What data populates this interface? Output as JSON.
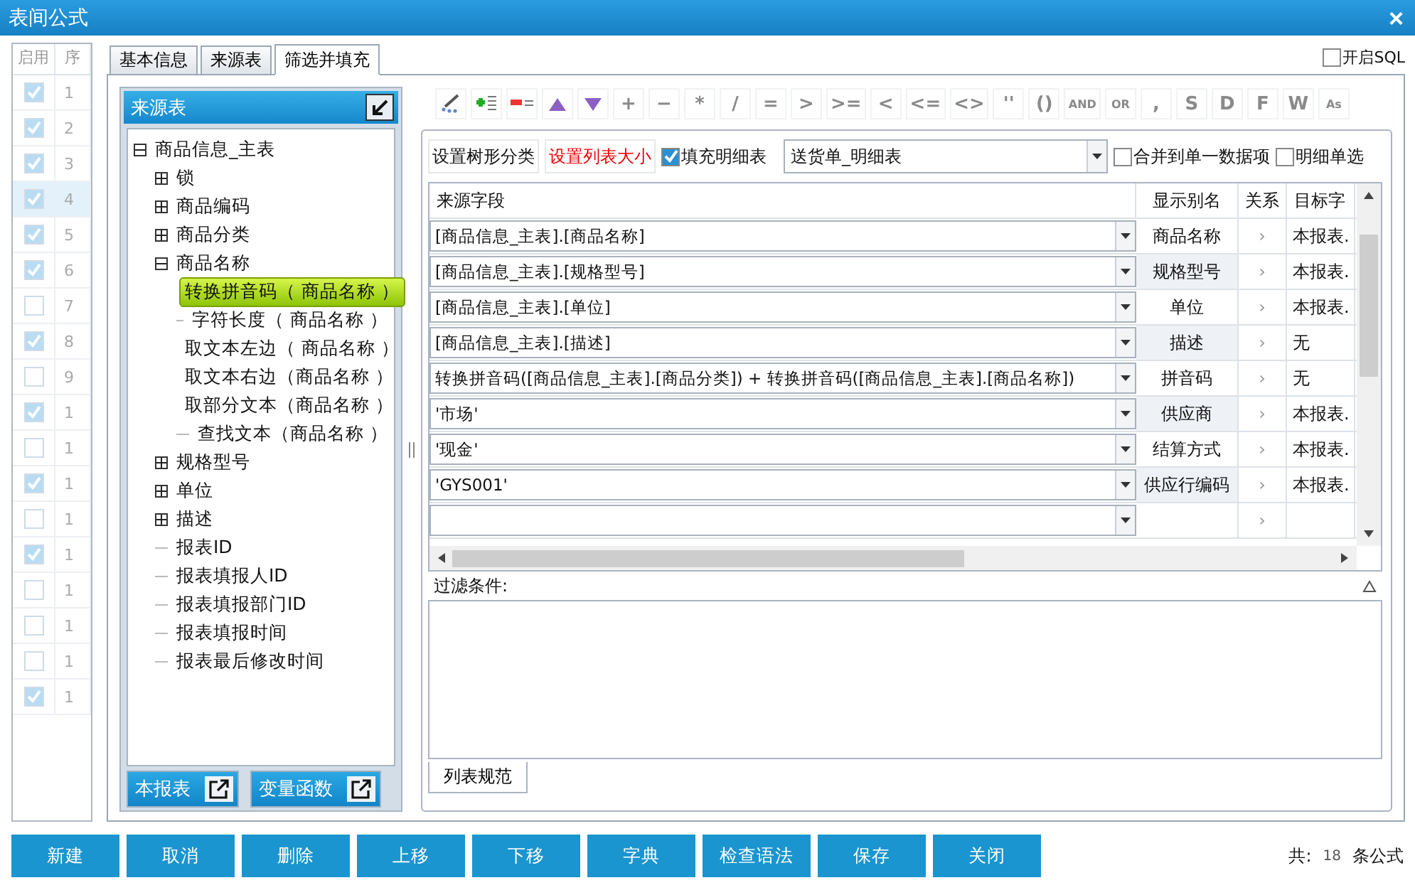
{
  "window": {
    "title": "表间公式",
    "close": "×"
  },
  "formula_list": {
    "columns": [
      "启用",
      "序"
    ],
    "rows": [
      {
        "enabled": true,
        "seq": "1",
        "selected": false
      },
      {
        "enabled": true,
        "seq": "2",
        "selected": false
      },
      {
        "enabled": true,
        "seq": "3",
        "selected": false
      },
      {
        "enabled": true,
        "seq": "4",
        "selected": true
      },
      {
        "enabled": true,
        "seq": "5",
        "selected": false
      },
      {
        "enabled": true,
        "seq": "6",
        "selected": false
      },
      {
        "enabled": false,
        "seq": "7",
        "selected": false
      },
      {
        "enabled": true,
        "seq": "8",
        "selected": false
      },
      {
        "enabled": false,
        "seq": "9",
        "selected": false
      },
      {
        "enabled": true,
        "seq": "1",
        "selected": false
      },
      {
        "enabled": false,
        "seq": "1",
        "selected": false
      },
      {
        "enabled": true,
        "seq": "1",
        "selected": false
      },
      {
        "enabled": false,
        "seq": "1",
        "selected": false
      },
      {
        "enabled": true,
        "seq": "1",
        "selected": false
      },
      {
        "enabled": false,
        "seq": "1",
        "selected": false
      },
      {
        "enabled": false,
        "seq": "1",
        "selected": false
      },
      {
        "enabled": false,
        "seq": "1",
        "selected": false
      },
      {
        "enabled": true,
        "seq": "1",
        "selected": false
      }
    ]
  },
  "tabs": [
    {
      "label": "基本信息",
      "selected": false
    },
    {
      "label": "来源表",
      "selected": false
    },
    {
      "label": "筛选并填充",
      "selected": true
    }
  ],
  "sql_toggle": {
    "label": "开启SQL",
    "checked": false
  },
  "source_panel": {
    "title": "来源表",
    "tree": [
      {
        "label": "商品信息_主表",
        "expanded": true,
        "selected": false,
        "children": [
          {
            "label": "锁",
            "expanded": false,
            "selected": false
          },
          {
            "label": "商品编码",
            "expanded": false,
            "selected": false
          },
          {
            "label": "商品分类",
            "expanded": false,
            "selected": false
          },
          {
            "label": "商品名称",
            "expanded": true,
            "selected": false,
            "children": [
              {
                "label": "转换拼音码（ 商品名称 ）",
                "selected": true
              },
              {
                "label": "字符长度（ 商品名称 ）",
                "selected": false
              },
              {
                "label": "取文本左边（ 商品名称 ）",
                "selected": false
              },
              {
                "label": "取文本右边（商品名称 ）",
                "selected": false
              },
              {
                "label": "取部分文本（商品名称 ）",
                "selected": false
              },
              {
                "label": "查找文本（商品名称 ）",
                "selected": false
              }
            ]
          },
          {
            "label": "规格型号",
            "expanded": false,
            "selected": false
          },
          {
            "label": "单位",
            "expanded": false,
            "selected": false
          },
          {
            "label": "描述",
            "expanded": false,
            "selected": false
          },
          {
            "label": "报表ID",
            "selected": false
          },
          {
            "label": "报表填报人ID",
            "selected": false
          },
          {
            "label": "报表填报部门ID",
            "selected": false
          },
          {
            "label": "报表填报时间",
            "selected": false
          },
          {
            "label": "报表最后修改时间",
            "selected": false
          }
        ]
      }
    ],
    "buttons": [
      "本报表",
      "变量函数"
    ]
  },
  "toolbar": {
    "icon_tools": [
      {
        "kind": "wand"
      },
      {
        "kind": "addrow"
      },
      {
        "kind": "delrow"
      },
      {
        "kind": "up"
      },
      {
        "kind": "down"
      }
    ],
    "operators": [
      "+",
      "−",
      "*",
      "/",
      "=",
      ">",
      ">=",
      "<",
      "<=",
      "<>",
      "''",
      "()",
      "AND",
      "OR",
      ",",
      "S",
      "D",
      "F",
      "W",
      "As"
    ]
  },
  "options": {
    "tree_category": "设置树形分类",
    "list_size": "设置列表大小",
    "fill_detail": {
      "label": "填充明细表",
      "checked": true
    },
    "detail_table": "送货单_明细表",
    "merge_single": {
      "label": "合并到单一数据项",
      "checked": false
    },
    "detail_single": {
      "label": "明细单选",
      "checked": false
    }
  },
  "mapping": {
    "columns": [
      "来源字段",
      "显示别名",
      "关系",
      "目标字"
    ],
    "rows": [
      {
        "source": "[商品信息_主表].[商品名称]",
        "alias": "商品名称",
        "relation": "›",
        "target": "本报表."
      },
      {
        "source": "[商品信息_主表].[规格型号]",
        "alias": "规格型号",
        "relation": "›",
        "target": "本报表."
      },
      {
        "source": "[商品信息_主表].[单位]",
        "alias": "单位",
        "relation": "›",
        "target": "本报表."
      },
      {
        "source": "[商品信息_主表].[描述]",
        "alias": "描述",
        "relation": "›",
        "target": "无"
      },
      {
        "source": "转换拼音码([商品信息_主表].[商品分类]) + 转换拼音码([商品信息_主表].[商品名称])",
        "alias": "拼音码",
        "relation": "›",
        "target": "无"
      },
      {
        "source": "'市场'",
        "alias": "供应商",
        "relation": "›",
        "target": "本报表."
      },
      {
        "source": "'现金'",
        "alias": "结算方式",
        "relation": "›",
        "target": "本报表."
      },
      {
        "source": "'GYS001'",
        "alias": "供应行编码",
        "relation": "›",
        "target": "本报表."
      },
      {
        "relation": "›"
      }
    ]
  },
  "filter": {
    "label": "过滤条件:"
  },
  "bottom_tabs": [
    {
      "label": "列表规范",
      "selected": true
    }
  ],
  "actions": [
    "新建",
    "取消",
    "删除",
    "上移",
    "下移",
    "字典",
    "检查语法",
    "保存",
    "关闭"
  ],
  "total": {
    "prefix": "共:",
    "count": "18",
    "suffix": "条公式"
  }
}
